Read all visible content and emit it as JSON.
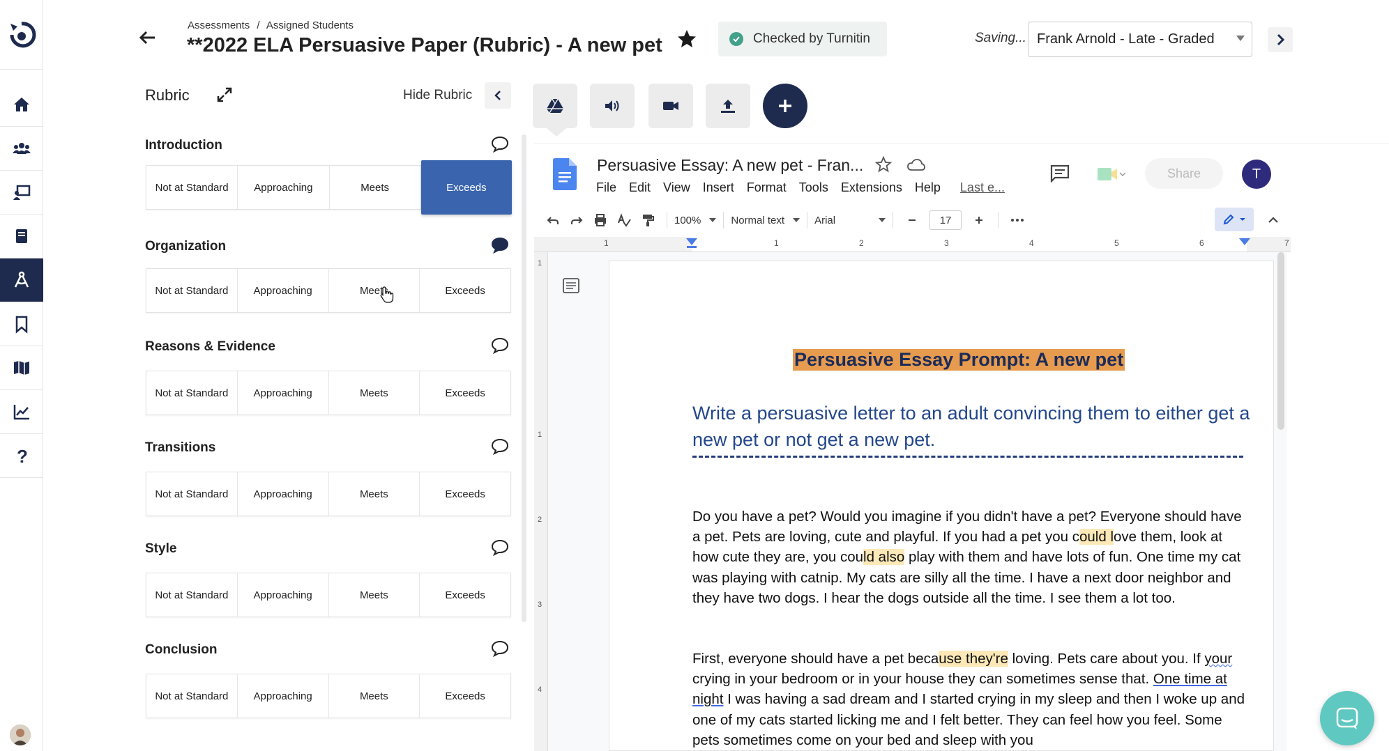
{
  "header": {
    "breadcrumbs": [
      "Assessments",
      "/",
      "Assigned Students"
    ],
    "title": "**2022 ELA Persuasive Paper (Rubric) - A new pet",
    "turnitin": "Checked by Turnitin",
    "saving": "Saving...",
    "student": "Frank Arnold - Late - Graded"
  },
  "rubric": {
    "title": "Rubric",
    "hide_label": "Hide Rubric",
    "levels": [
      "Not at Standard",
      "Approaching",
      "Meets",
      "Exceeds"
    ],
    "sections": [
      {
        "name": "Introduction",
        "selected": "Exceeds"
      },
      {
        "name": "Organization",
        "selected": ""
      },
      {
        "name": "Reasons & Evidence",
        "selected": ""
      },
      {
        "name": "Transitions",
        "selected": ""
      },
      {
        "name": "Style",
        "selected": ""
      },
      {
        "name": "Conclusion",
        "selected": ""
      }
    ]
  },
  "tools": [
    "drive-icon",
    "audio-icon",
    "video-icon",
    "upload-icon",
    "plus-icon"
  ],
  "doc": {
    "name": "Persuasive Essay: A new pet - Fran...",
    "menu": [
      "File",
      "Edit",
      "View",
      "Insert",
      "Format",
      "Tools",
      "Extensions",
      "Help"
    ],
    "last_edit": "Last e...",
    "share": "Share",
    "avatar": "T",
    "zoom": "100%",
    "style": "Normal text",
    "font": "Arial",
    "font_size": "17",
    "ruler_top": [
      "1",
      "1",
      "2",
      "3",
      "4",
      "5",
      "6",
      "7"
    ],
    "ruler_side": [
      "1",
      "1",
      "2",
      "3",
      "4"
    ],
    "prompt_title": "Persuasive Essay Prompt: A new pet",
    "prompt_sub": "Write a persuasive letter to an adult convincing them to either get a new pet or not get a new pet.",
    "p1_a": "Do you have a pet? Would you imagine if you didn't have a pet? Everyone should have a pet. Pets are loving, cute and playful. If you had a pet you c",
    "p1_h1": "ould l",
    "p1_b": "ove them, look at how cute they are, you cou",
    "p1_h2": "ld also",
    "p1_c": " play with them and have lots of fun. One time my cat was playing with catnip. My cats are silly all the time. I have a next door neighbor and they have two dogs. I hear the dogs outside all the time. I see them a lot too.",
    "p2_a": "First, everyone should have a pet beca",
    "p2_h": "use they're",
    "p2_b": " loving. Pets care about you. If ",
    "p2_u1": "your",
    "p2_c": " crying in your bedroom or in your house they can sometimes sense that. ",
    "p2_u2": "One time at night",
    "p2_d": " I was having a sad dream and I started crying in my sleep and then I woke up and one of my cats started licking me and I felt better. They can feel how you feel. Some pets sometimes come on your bed and sleep with you"
  },
  "colors": {
    "nav_active": "#1e2b4e",
    "selected_level": "#3a65ae",
    "prompt_highlight": "#e79b4f",
    "text_highlight": "#fce9b7",
    "intercom": "#5fc9c1"
  }
}
